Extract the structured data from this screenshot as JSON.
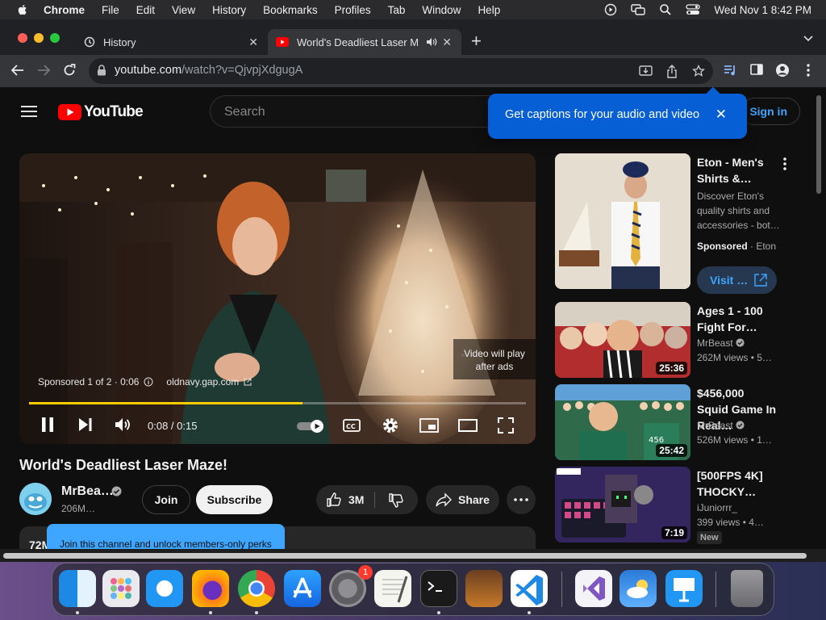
{
  "menubar": {
    "app_name": "Chrome",
    "items": [
      "File",
      "Edit",
      "View",
      "History",
      "Bookmarks",
      "Profiles",
      "Tab",
      "Window",
      "Help"
    ],
    "clock": "Wed Nov 1  8:42 PM"
  },
  "tabs": [
    {
      "title": "History",
      "icon": "history-icon"
    },
    {
      "title": "World's Deadliest Laser M",
      "icon": "youtube-icon",
      "active": true
    }
  ],
  "address_bar": {
    "host": "youtube.com",
    "path": "/watch?v=QjvpjXdgugA"
  },
  "youtube": {
    "logo_text": "YouTube",
    "search_placeholder": "Search",
    "sign_in": "Sign in",
    "captions_tip": "Get captions for your audio and video"
  },
  "player": {
    "skip_notice": "Video will play after ads",
    "sponsor_text": "Sponsored 1 of 2 · 0:06",
    "ad_link": "oldnavy.gap.com",
    "time": "0:08 / 0:15",
    "progress": 0.55
  },
  "video": {
    "title": "World's Deadliest Laser Maze!",
    "channel": "MrBea…",
    "subscribers": "206M…",
    "join": "Join",
    "subscribe": "Subscribe",
    "likes": "3M",
    "share": "Share",
    "views_partial": "72M",
    "join_tip": "Join this channel and unlock members-only perks"
  },
  "recommendations": [
    {
      "type": "ad",
      "title": "Eton - Men's Shirts &…",
      "description": "Discover Eton's quality shirts and accessories - bot…",
      "sponsored": "Sponsored",
      "advertiser": "Eton",
      "cta": "Visit …"
    },
    {
      "title": "Ages 1 - 100 Fight For…",
      "channel": "MrBeast",
      "meta": "262M views  • 5…",
      "duration": "25:36"
    },
    {
      "title": "$456,000 Squid Game In Real…",
      "channel": "MrBeast",
      "meta": "526M views  • 1…",
      "duration": "25:42"
    },
    {
      "title": "[500FPS 4K] THOCKY…",
      "channel": "iJuniorrr_",
      "meta": "399 views  • 4…",
      "duration": "7:19",
      "badge": "New"
    }
  ],
  "dock": {
    "apps": [
      "Finder",
      "Launchpad",
      "Safari",
      "Firefox",
      "Chrome",
      "App Store",
      "System Settings",
      "TextEdit",
      "Terminal",
      "GarageBand",
      "VS Code",
      "Visual Studio",
      "Weather",
      "Keynote",
      "Trash"
    ],
    "settings_badge": "1"
  },
  "colors": {
    "accent": "#3ea6ff",
    "youtube_red": "#ff0000",
    "tip_blue": "#065fd4",
    "ad_progress": "#ffcc00"
  }
}
